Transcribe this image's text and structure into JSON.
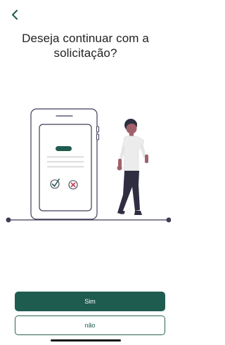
{
  "header": {
    "back_icon": "chevron-left-icon"
  },
  "title": "Deseja continuar com a solicitação?",
  "illustration": {
    "check_icon": "check-circle-icon",
    "cross_icon": "x-circle-icon"
  },
  "actions": {
    "yes_label": "Sim",
    "no_label": "não"
  },
  "colors": {
    "primary": "#1f5c50",
    "accent_red": "#c73b50",
    "accent_green": "#1f5c50",
    "text": "#222222"
  }
}
